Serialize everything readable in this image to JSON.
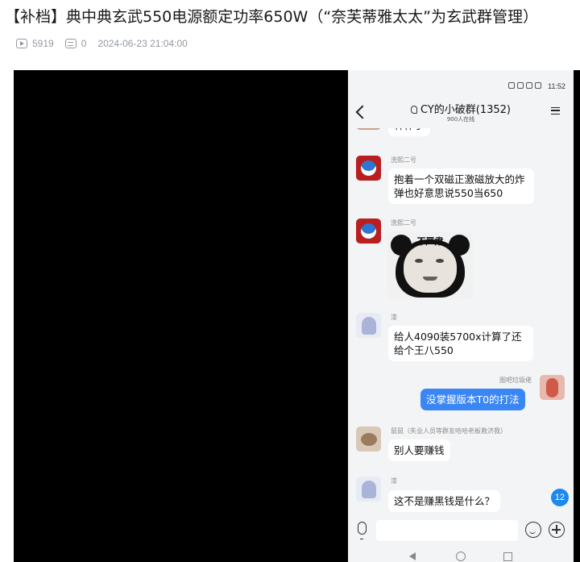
{
  "post": {
    "title": "【补档】典中典玄武550电源额定功率650W（“奈芙蒂雅太太”为玄武群管理）",
    "views": "5919",
    "comments": "0",
    "datetime": "2024-06-23 21:04:00"
  },
  "phone": {
    "status_time": "11:52",
    "group_title": "CY的小破群(1352)",
    "online_count": "900人在线",
    "unread_badge": "12",
    "messages": [
      {
        "sender": "",
        "text": "释怀了"
      },
      {
        "sender": "洗熙二号",
        "text": "抱着一个双磁正激磁放大的炸弹也好意思说550当650"
      },
      {
        "sender": "洗熙二号",
        "sticker_caption": "不严肃"
      },
      {
        "sender": "漆",
        "text": "给人4090装5700x计算了还给个王八550"
      },
      {
        "sender": "图吧垃圾佬",
        "text": "没掌握版本T0的打法"
      },
      {
        "sender": "鼠鼠（失业人员等群友哈哈老板救济我）",
        "text": "别人要赚钱"
      },
      {
        "sender": "漆",
        "text": "这不是赚黑钱是什么？"
      }
    ]
  },
  "colors": {
    "my_bubble": "#3b86f5",
    "badge": "#1c89f0",
    "video_bg": "#000000"
  },
  "icons": [
    "view-icon",
    "comment-icon",
    "back-icon",
    "menu-icon",
    "mic-icon",
    "emoji-icon",
    "plus-icon"
  ]
}
